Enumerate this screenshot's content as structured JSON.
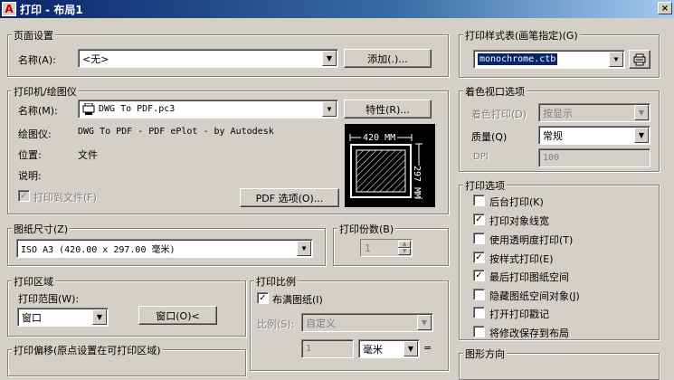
{
  "window": {
    "icon_glyph": "A",
    "title": "打印 - 布局1",
    "close_glyph": "×"
  },
  "page_setup": {
    "title": "页面设置",
    "name_label": "名称(A):",
    "name_value": "<无>",
    "add_button": "添加(.)..."
  },
  "printer": {
    "title": "打印机/绘图仪",
    "name_label": "名称(M):",
    "name_value": "DWG To PDF.pc3",
    "properties_button": "特性(R)...",
    "plotter_label": "绘图仪:",
    "plotter_value": "DWG To PDF - PDF ePlot - by Autodesk",
    "location_label": "位置:",
    "location_value": "文件",
    "description_label": "说明:",
    "print_to_file_label": "打印到文件(F)",
    "print_to_file_checked": true,
    "pdf_options_button": "PDF 选项(O)...",
    "paper_width_label": "420 MM",
    "paper_height_label": "297 MM"
  },
  "paper_size": {
    "title": "图纸尺寸(Z)",
    "value": "ISO A3 (420.00 x 297.00 毫米)"
  },
  "copies": {
    "title": "打印份数(B)",
    "value": "1"
  },
  "plot_area": {
    "title": "打印区域",
    "range_label": "打印范围(W):",
    "range_value": "窗口",
    "window_button": "窗口(O)<"
  },
  "plot_offset": {
    "title": "打印偏移(原点设置在可打印区域)"
  },
  "plot_scale": {
    "title": "打印比例",
    "fit_label": "布满图纸(I)",
    "fit_checked": true,
    "scale_label": "比例(S):",
    "scale_value": "自定义",
    "units_value": "1",
    "units_type": "毫米",
    "equals": "="
  },
  "plot_style": {
    "title": "打印样式表(画笔指定)(G)",
    "value": "monochrome.ctb"
  },
  "shaded_viewport": {
    "title": "着色视口选项",
    "shade_label": "着色打印(D)",
    "shade_value": "按显示",
    "quality_label": "质量(Q)",
    "quality_value": "常规",
    "dpi_label": "DPI",
    "dpi_value": "100"
  },
  "plot_options": {
    "title": "打印选项",
    "items": [
      {
        "label": "后台打印(K)",
        "checked": false
      },
      {
        "label": "打印对象线宽",
        "checked": true
      },
      {
        "label": "使用透明度打印(T)",
        "checked": false
      },
      {
        "label": "按样式打印(E)",
        "checked": true
      },
      {
        "label": "最后打印图纸空间",
        "checked": true
      },
      {
        "label": "隐藏图纸空间对象(J)",
        "checked": false
      },
      {
        "label": "打开打印戳记",
        "checked": false
      },
      {
        "label": "将修改保存到布局",
        "checked": false
      }
    ]
  },
  "drawing_orientation": {
    "title": "图形方向"
  }
}
